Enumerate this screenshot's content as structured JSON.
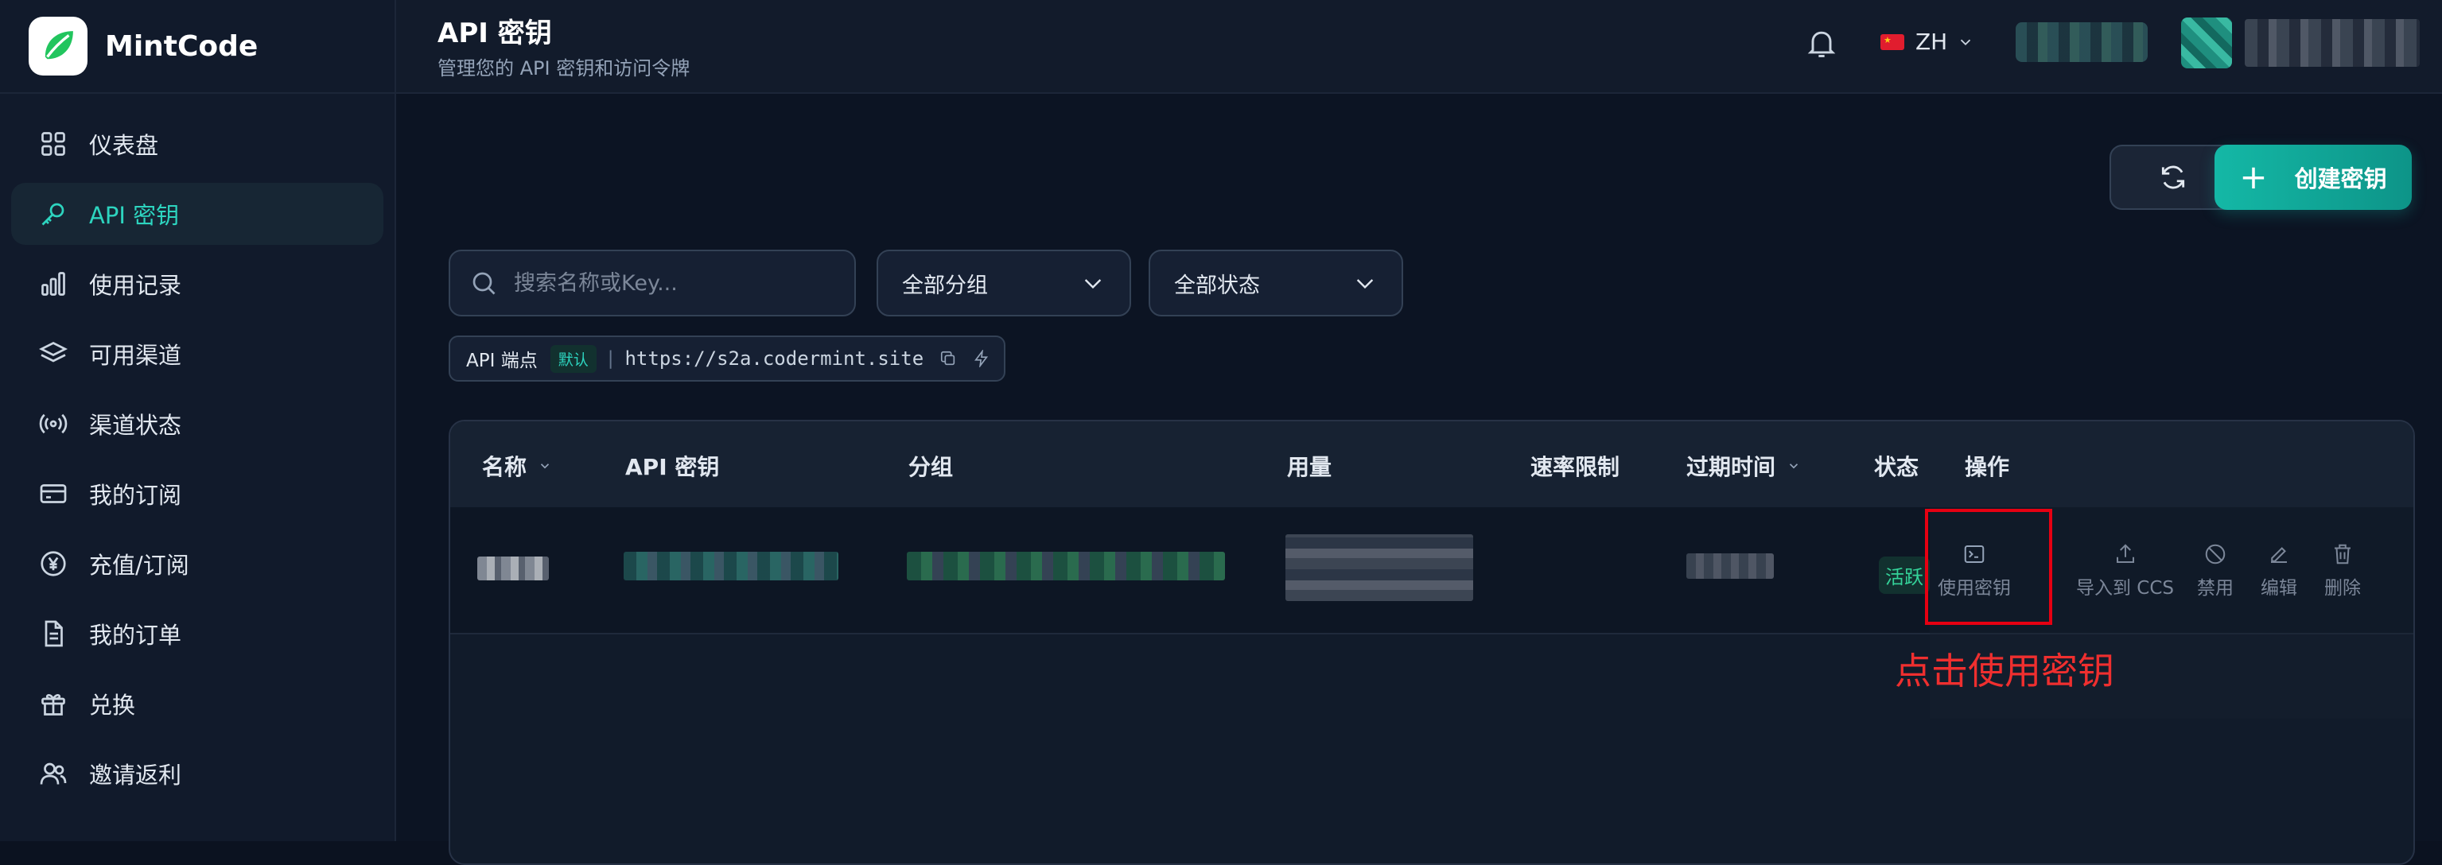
{
  "brand": {
    "name": "MintCode"
  },
  "sidebar": {
    "items": [
      {
        "label": "仪表盘",
        "icon": "dashboard-grid-icon",
        "active": false
      },
      {
        "label": "API 密钥",
        "icon": "key-icon",
        "active": true
      },
      {
        "label": "使用记录",
        "icon": "bar-chart-icon",
        "active": false
      },
      {
        "label": "可用渠道",
        "icon": "layers-icon",
        "active": false
      },
      {
        "label": "渠道状态",
        "icon": "broadcast-icon",
        "active": false
      },
      {
        "label": "我的订阅",
        "icon": "credit-card-icon",
        "active": false
      },
      {
        "label": "充值/订阅",
        "icon": "yen-coin-icon",
        "active": false
      },
      {
        "label": "我的订单",
        "icon": "document-icon",
        "active": false
      },
      {
        "label": "兑换",
        "icon": "gift-icon",
        "active": false
      },
      {
        "label": "邀请返利",
        "icon": "users-icon",
        "active": false
      }
    ]
  },
  "header": {
    "title": "API 密钥",
    "subtitle": "管理您的 API 密钥和访问令牌",
    "language": "ZH"
  },
  "toolbar": {
    "create_label": "创建密钥",
    "search_placeholder": "搜索名称或Key...",
    "group_filter": "全部分组",
    "status_filter": "全部状态"
  },
  "endpoint": {
    "label": "API 端点",
    "badge": "默认",
    "url": "https://s2a.codermint.site"
  },
  "table": {
    "columns": {
      "name": "名称",
      "key": "API 密钥",
      "group": "分组",
      "usage": "用量",
      "rate_limit": "速率限制",
      "expires": "过期时间",
      "status": "状态",
      "actions": "操作"
    },
    "row": {
      "status": "活跃",
      "actions": {
        "use": "使用密钥",
        "import": "导入到 CCS",
        "disable": "禁用",
        "edit": "编辑",
        "delete": "删除"
      }
    }
  },
  "annotation": {
    "text": "点击使用密钥",
    "color": "#e60012"
  },
  "colors": {
    "accent": "#14b8a6",
    "background": "#0b1220",
    "active_status": "#34d399"
  }
}
